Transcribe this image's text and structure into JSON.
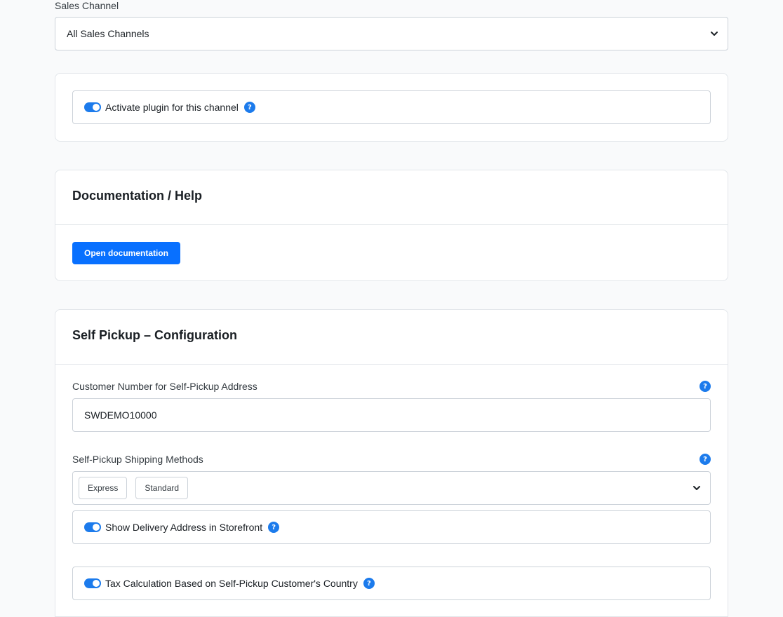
{
  "sales_channel": {
    "label": "Sales Channel",
    "selected": "All Sales Channels"
  },
  "activation": {
    "label": "Activate plugin for this channel",
    "enabled": true
  },
  "documentation": {
    "title": "Documentation / Help",
    "button_label": "Open documentation"
  },
  "self_pickup": {
    "title": "Self Pickup – Configuration",
    "customer_number": {
      "label": "Customer Number for Self-Pickup Address",
      "value": "SWDEMO10000"
    },
    "shipping_methods": {
      "label": "Self-Pickup Shipping Methods",
      "selected": [
        "Express",
        "Standard"
      ]
    },
    "show_delivery_address": {
      "label": "Show Delivery Address in Storefront",
      "enabled": true
    },
    "tax_calculation": {
      "label": "Tax Calculation Based on Self-Pickup Customer's Country",
      "enabled": true
    }
  },
  "icons": {
    "help": "?",
    "toggle": "toggle-switch-icon",
    "chevron": "chevron-down-icon"
  },
  "colors": {
    "accent": "#1c7bec",
    "primary_button": "#0870ff",
    "border": "#ccd2d9",
    "background": "#f9fafb"
  }
}
